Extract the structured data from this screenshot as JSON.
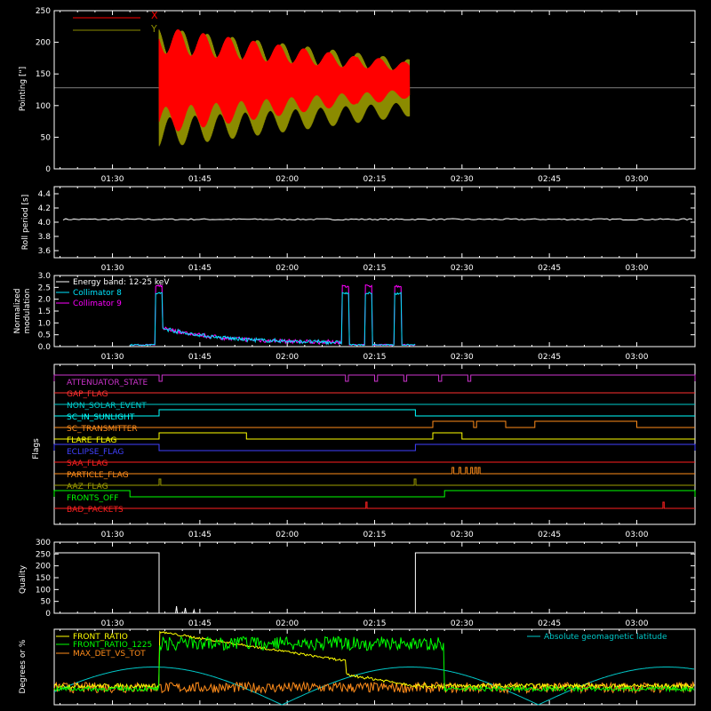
{
  "colors": {
    "background": "#000000",
    "axis": "#ffffff",
    "x_pointing": "#ff0000",
    "y_pointing": "#8b8b00",
    "collimator8": "#00e5ff",
    "collimator9": "#ff00ff",
    "front_ratio": "#ffff00",
    "front_ratio_1225": "#00ff00",
    "max_det_vs_tot": "#ff8c1a",
    "geomag_lat": "#00c8c8"
  },
  "time_axis": {
    "start_minutes": 80,
    "end_minutes": 190,
    "tick_minutes": [
      90,
      105,
      120,
      135,
      150,
      165,
      180
    ],
    "tick_labels": [
      "01:30",
      "01:45",
      "02:00",
      "02:15",
      "02:30",
      "02:45",
      "03:00"
    ]
  },
  "chart_data": [
    {
      "type": "line",
      "name": "pointing",
      "ylabel": "Pointing [\"]",
      "ylim": [
        0,
        250
      ],
      "y_ticks": [
        0,
        50,
        100,
        150,
        200,
        250
      ],
      "grid": false,
      "legend": "top-left",
      "reference_line": 128,
      "series": [
        {
          "name": "X",
          "color_key": "x_pointing",
          "start_minutes": 98,
          "end_minutes": 141,
          "center": 140,
          "amplitude_start": 85,
          "amplitude_end": 25,
          "amplitude_jump": [
            [
              132,
              40
            ]
          ]
        },
        {
          "name": "Y",
          "color_key": "y_pointing",
          "start_minutes": 98,
          "end_minutes": 141,
          "center": 128,
          "amplitude_start": 95,
          "amplitude_end": 45
        }
      ]
    },
    {
      "type": "line",
      "name": "roll-period",
      "ylabel": "Roll period [s]",
      "ylim": [
        3.5,
        4.5
      ],
      "y_ticks": [
        3.6,
        3.8,
        4.0,
        4.2,
        4.4
      ],
      "grid": false,
      "series": [
        {
          "name": "",
          "color_key": "axis",
          "constant": 4.04
        }
      ]
    },
    {
      "type": "line",
      "name": "modulation",
      "ylabel": "Normalized modulation",
      "ylabel_lines": [
        "Normalized",
        "modulation"
      ],
      "ylim": [
        0,
        3
      ],
      "y_ticks": [
        0.0,
        0.5,
        1.0,
        1.5,
        2.0,
        2.5,
        3.0
      ],
      "grid": false,
      "legend": "top-left",
      "legend_title": "Energy band: 12-25 keV",
      "data_range_minutes": [
        93,
        142
      ],
      "spike_minutes": [
        98,
        130,
        134,
        139,
        144,
        148
      ],
      "series": [
        {
          "name": "Collimator 8",
          "color_key": "collimator8"
        },
        {
          "name": "Collimator 9",
          "color_key": "collimator9"
        }
      ]
    },
    {
      "type": "line",
      "name": "flags",
      "ylabel": "Flags",
      "grid": false,
      "flags": [
        {
          "name": "ATTENUATOR_STATE",
          "color": "#cc33cc",
          "on": [
            [
              80,
              98
            ],
            [
              98.5,
              130
            ],
            [
              130.5,
              135
            ],
            [
              135.5,
              140
            ],
            [
              140.5,
              146
            ],
            [
              146.5,
              151
            ],
            [
              151.5,
              190
            ]
          ]
        },
        {
          "name": "GAP_FLAG",
          "color": "#ff3030",
          "on": []
        },
        {
          "name": "NON_SOLAR_EVENT",
          "color": "#00cccc",
          "on": []
        },
        {
          "name": "SC_IN_SUNLIGHT",
          "color": "#00ffff",
          "on": [
            [
              98,
              142
            ]
          ]
        },
        {
          "name": "SC_TRANSMITTER",
          "color": "#ff8c1a",
          "on": [
            [
              145,
              152
            ],
            [
              152.5,
              157.5
            ],
            [
              162.5,
              180
            ]
          ]
        },
        {
          "name": "FLARE_FLAG",
          "color": "#ffff00",
          "on": [
            [
              98,
              113
            ],
            [
              145,
              150
            ]
          ]
        },
        {
          "name": "ECLIPSE_FLAG",
          "color": "#4040ff",
          "on": [
            [
              80,
              98
            ],
            [
              142,
              190
            ]
          ]
        },
        {
          "name": "SAA_FLAG",
          "color": "#ff2020",
          "on": []
        },
        {
          "name": "PARTICLE_FLAG",
          "color": "#ff8c1a",
          "on": [
            [
              148.3,
              148.6
            ],
            [
              149.5,
              149.8
            ],
            [
              150.6,
              150.9
            ],
            [
              151.5,
              151.8
            ],
            [
              152.2,
              152.5
            ],
            [
              152.8,
              153.1
            ]
          ]
        },
        {
          "name": "AAZ_FLAG",
          "color": "#a0a000",
          "on": [
            [
              98,
              98.3
            ],
            [
              141.8,
              142.1
            ]
          ]
        },
        {
          "name": "FRONTS_OFF",
          "color": "#00ff00",
          "on": [
            [
              80,
              93
            ],
            [
              147,
              190
            ]
          ]
        },
        {
          "name": "BAD_PACKETS",
          "color": "#ff2020",
          "on": [
            [
              133.5,
              133.7
            ],
            [
              184.5,
              184.7
            ]
          ]
        }
      ]
    },
    {
      "type": "line",
      "name": "quality",
      "ylabel": "Quality",
      "ylim": [
        0,
        300
      ],
      "y_ticks": [
        0,
        50,
        100,
        150,
        200,
        250,
        300
      ],
      "grid": false,
      "series": [
        {
          "name": "",
          "color_key": "axis",
          "high_value": 255,
          "low_value": 0,
          "high_ranges": [
            [
              80,
              98
            ],
            [
              142,
              190
            ]
          ]
        }
      ]
    },
    {
      "type": "line",
      "name": "ratios",
      "ylabel": "Degrees or %",
      "ylim": [
        0,
        100
      ],
      "grid": false,
      "legend": "top-left",
      "series": [
        {
          "name": "FRONT_RATIO",
          "color_key": "front_ratio"
        },
        {
          "name": "FRONT_RATIO_1225",
          "color_key": "front_ratio_1225"
        },
        {
          "name": "MAX_DET_VS_TOT",
          "color_key": "max_det_vs_tot"
        },
        {
          "name": "Absolute geomagnetic latitude",
          "color_key": "geomag_lat"
        }
      ]
    }
  ],
  "labels": {
    "pointing_ylabel": "Pointing [\"]",
    "pointing_legend_x": "X",
    "pointing_legend_y": "Y",
    "roll_ylabel": "Roll period [s]",
    "modulation_ylabel_1": "Normalized",
    "modulation_ylabel_2": "modulation",
    "modulation_energy": "Energy band: 12-25 keV",
    "modulation_c8": "Collimator 8",
    "modulation_c9": "Collimator 9",
    "flags_ylabel": "Flags",
    "quality_ylabel": "Quality",
    "ratios_ylabel": "Degrees or %",
    "ratios_fr": "FRONT_RATIO",
    "ratios_fr1225": "FRONT_RATIO_1225",
    "ratios_maxdet": "MAX_DET_VS_TOT",
    "ratios_geomag": "Absolute geomagnetic latitude"
  }
}
